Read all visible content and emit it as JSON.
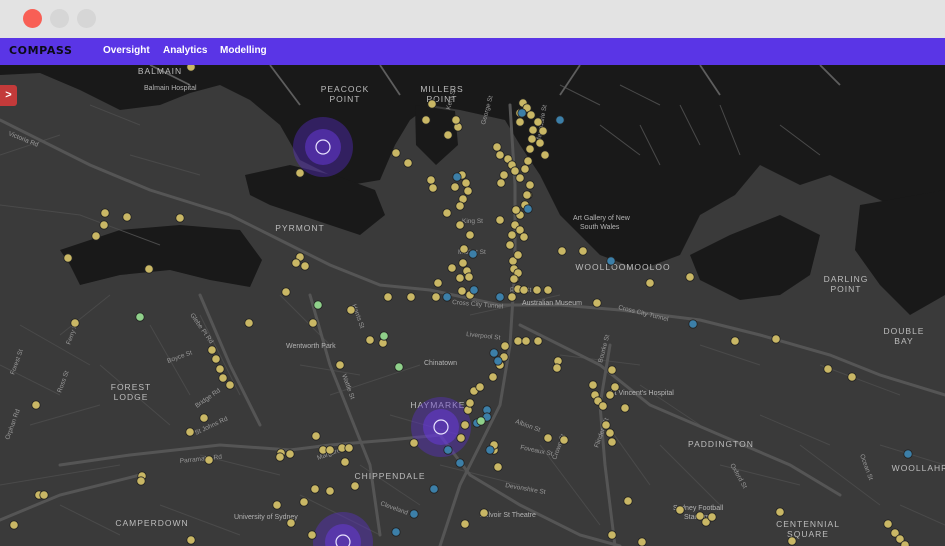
{
  "nav": {
    "logo": "COMPASS",
    "items": [
      "Oversight",
      "Analytics",
      "Modelling"
    ]
  },
  "sidebar_toggle": {
    "label": ">"
  },
  "colors": {
    "nav_background": "#5a35e6",
    "map_land": "#3a3a3a",
    "map_water": "#191919",
    "marker_yellow": "#c9b765",
    "marker_blue": "#3c7fa8",
    "marker_green": "#8fd08a",
    "cluster_halo": "#5b2cd6",
    "toggle_red": "#c33a3a"
  },
  "map": {
    "area_labels": {
      "balmain": "BALMAIN",
      "peacock_point": [
        "PEACOCK",
        "POINT"
      ],
      "millers_point": [
        "MILLERS",
        "POINT"
      ],
      "pyrmont": "PYRMONT",
      "woolloomooloo": "WOOLLOOMOOLOO",
      "darling_point": [
        "DARLING",
        "POINT"
      ],
      "double_bay": [
        "DOUBLE",
        "BAY"
      ],
      "forest_lodge": [
        "FOREST",
        "LODGE"
      ],
      "haymarket": "HAYMARKET",
      "chippendale": "CHIPPENDALE",
      "paddington": "PADDINGTON",
      "woollahra": "WOOLLAHR",
      "camperdown": "CAMPERDOWN",
      "centennial_square": [
        "CENTENNIAL",
        "SQUARE"
      ]
    },
    "poi_labels": {
      "balmain_hospital": "Balmain Hospital",
      "art_gallery": [
        "Art Gallery of New",
        "South Wales"
      ],
      "australian_museum": "Australian Museum",
      "chinatown": "Chinatown",
      "wentworth_park": "Wentworth Park",
      "st_vincents": "St Vincent's Hospital",
      "university_of_sydney": "University of Sydney",
      "sydney_football_stadium": [
        "Sydney Football",
        "Stadium"
      ],
      "belvoir_theatre": "Belvoir St Theatre"
    },
    "street_labels": {
      "victoria_rd": "Victoria Rd",
      "cross_city_tunnel": "Cross City Tunnel",
      "cross_city_tunnel_east": "Cross City Tunnel",
      "parramatta_rd": "Parramatta Rd",
      "liverpool_st": "Liverpool St",
      "harris_st": "Harris St",
      "wattle_st": "Wattle St",
      "glebe_pt_rd": "Glebe Pt Rd",
      "bridge_rd": "Bridge Rd",
      "ross_st": "Ross St",
      "st_johns_rd": "St Johns Rd",
      "boyce_st": "Boyce St",
      "albion_st": "Albion St",
      "foveaux_st": "Foveaux St",
      "crown_st": "Crown St",
      "flinders_st": "Flinders St",
      "oxford_st": "Oxford St",
      "ocean_st": "Ocean St",
      "cleveland_st": "Cleveland St",
      "macquarie_st": "Macquarie St",
      "george_st": "George St",
      "king_st": "King St",
      "park_st": "Park St",
      "market_st": "Market St",
      "kent_st": "Kent St",
      "bourke_st": "Bourke St",
      "devonshire_st": "Devonshire St",
      "forest_st": "Forest St",
      "ferry_rd": "Ferry Rd",
      "orphan_rd": "Orphan Rd",
      "margaret_st": "Margaret St"
    }
  }
}
